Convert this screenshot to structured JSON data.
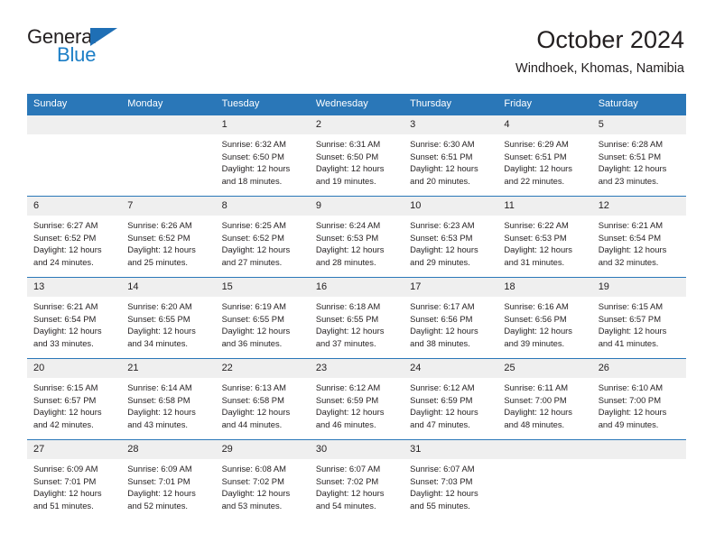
{
  "brand": {
    "name_top": "General",
    "name_bottom": "Blue",
    "accent_color": "#1b7ec6",
    "triangle_color": "#1f6fb5"
  },
  "header": {
    "title": "October 2024",
    "subtitle": "Windhoek, Khomas, Namibia"
  },
  "theme": {
    "header_bg": "#2a77b8",
    "daynum_bg": "#efefef",
    "text_color": "#231f20"
  },
  "columns": [
    "Sunday",
    "Monday",
    "Tuesday",
    "Wednesday",
    "Thursday",
    "Friday",
    "Saturday"
  ],
  "weeks": [
    [
      {
        "day": "",
        "empty": true
      },
      {
        "day": "",
        "empty": true
      },
      {
        "day": "1",
        "sunrise": "Sunrise: 6:32 AM",
        "sunset": "Sunset: 6:50 PM",
        "daylight": "Daylight: 12 hours and 18 minutes."
      },
      {
        "day": "2",
        "sunrise": "Sunrise: 6:31 AM",
        "sunset": "Sunset: 6:50 PM",
        "daylight": "Daylight: 12 hours and 19 minutes."
      },
      {
        "day": "3",
        "sunrise": "Sunrise: 6:30 AM",
        "sunset": "Sunset: 6:51 PM",
        "daylight": "Daylight: 12 hours and 20 minutes."
      },
      {
        "day": "4",
        "sunrise": "Sunrise: 6:29 AM",
        "sunset": "Sunset: 6:51 PM",
        "daylight": "Daylight: 12 hours and 22 minutes."
      },
      {
        "day": "5",
        "sunrise": "Sunrise: 6:28 AM",
        "sunset": "Sunset: 6:51 PM",
        "daylight": "Daylight: 12 hours and 23 minutes."
      }
    ],
    [
      {
        "day": "6",
        "sunrise": "Sunrise: 6:27 AM",
        "sunset": "Sunset: 6:52 PM",
        "daylight": "Daylight: 12 hours and 24 minutes."
      },
      {
        "day": "7",
        "sunrise": "Sunrise: 6:26 AM",
        "sunset": "Sunset: 6:52 PM",
        "daylight": "Daylight: 12 hours and 25 minutes."
      },
      {
        "day": "8",
        "sunrise": "Sunrise: 6:25 AM",
        "sunset": "Sunset: 6:52 PM",
        "daylight": "Daylight: 12 hours and 27 minutes."
      },
      {
        "day": "9",
        "sunrise": "Sunrise: 6:24 AM",
        "sunset": "Sunset: 6:53 PM",
        "daylight": "Daylight: 12 hours and 28 minutes."
      },
      {
        "day": "10",
        "sunrise": "Sunrise: 6:23 AM",
        "sunset": "Sunset: 6:53 PM",
        "daylight": "Daylight: 12 hours and 29 minutes."
      },
      {
        "day": "11",
        "sunrise": "Sunrise: 6:22 AM",
        "sunset": "Sunset: 6:53 PM",
        "daylight": "Daylight: 12 hours and 31 minutes."
      },
      {
        "day": "12",
        "sunrise": "Sunrise: 6:21 AM",
        "sunset": "Sunset: 6:54 PM",
        "daylight": "Daylight: 12 hours and 32 minutes."
      }
    ],
    [
      {
        "day": "13",
        "sunrise": "Sunrise: 6:21 AM",
        "sunset": "Sunset: 6:54 PM",
        "daylight": "Daylight: 12 hours and 33 minutes."
      },
      {
        "day": "14",
        "sunrise": "Sunrise: 6:20 AM",
        "sunset": "Sunset: 6:55 PM",
        "daylight": "Daylight: 12 hours and 34 minutes."
      },
      {
        "day": "15",
        "sunrise": "Sunrise: 6:19 AM",
        "sunset": "Sunset: 6:55 PM",
        "daylight": "Daylight: 12 hours and 36 minutes."
      },
      {
        "day": "16",
        "sunrise": "Sunrise: 6:18 AM",
        "sunset": "Sunset: 6:55 PM",
        "daylight": "Daylight: 12 hours and 37 minutes."
      },
      {
        "day": "17",
        "sunrise": "Sunrise: 6:17 AM",
        "sunset": "Sunset: 6:56 PM",
        "daylight": "Daylight: 12 hours and 38 minutes."
      },
      {
        "day": "18",
        "sunrise": "Sunrise: 6:16 AM",
        "sunset": "Sunset: 6:56 PM",
        "daylight": "Daylight: 12 hours and 39 minutes."
      },
      {
        "day": "19",
        "sunrise": "Sunrise: 6:15 AM",
        "sunset": "Sunset: 6:57 PM",
        "daylight": "Daylight: 12 hours and 41 minutes."
      }
    ],
    [
      {
        "day": "20",
        "sunrise": "Sunrise: 6:15 AM",
        "sunset": "Sunset: 6:57 PM",
        "daylight": "Daylight: 12 hours and 42 minutes."
      },
      {
        "day": "21",
        "sunrise": "Sunrise: 6:14 AM",
        "sunset": "Sunset: 6:58 PM",
        "daylight": "Daylight: 12 hours and 43 minutes."
      },
      {
        "day": "22",
        "sunrise": "Sunrise: 6:13 AM",
        "sunset": "Sunset: 6:58 PM",
        "daylight": "Daylight: 12 hours and 44 minutes."
      },
      {
        "day": "23",
        "sunrise": "Sunrise: 6:12 AM",
        "sunset": "Sunset: 6:59 PM",
        "daylight": "Daylight: 12 hours and 46 minutes."
      },
      {
        "day": "24",
        "sunrise": "Sunrise: 6:12 AM",
        "sunset": "Sunset: 6:59 PM",
        "daylight": "Daylight: 12 hours and 47 minutes."
      },
      {
        "day": "25",
        "sunrise": "Sunrise: 6:11 AM",
        "sunset": "Sunset: 7:00 PM",
        "daylight": "Daylight: 12 hours and 48 minutes."
      },
      {
        "day": "26",
        "sunrise": "Sunrise: 6:10 AM",
        "sunset": "Sunset: 7:00 PM",
        "daylight": "Daylight: 12 hours and 49 minutes."
      }
    ],
    [
      {
        "day": "27",
        "sunrise": "Sunrise: 6:09 AM",
        "sunset": "Sunset: 7:01 PM",
        "daylight": "Daylight: 12 hours and 51 minutes."
      },
      {
        "day": "28",
        "sunrise": "Sunrise: 6:09 AM",
        "sunset": "Sunset: 7:01 PM",
        "daylight": "Daylight: 12 hours and 52 minutes."
      },
      {
        "day": "29",
        "sunrise": "Sunrise: 6:08 AM",
        "sunset": "Sunset: 7:02 PM",
        "daylight": "Daylight: 12 hours and 53 minutes."
      },
      {
        "day": "30",
        "sunrise": "Sunrise: 6:07 AM",
        "sunset": "Sunset: 7:02 PM",
        "daylight": "Daylight: 12 hours and 54 minutes."
      },
      {
        "day": "31",
        "sunrise": "Sunrise: 6:07 AM",
        "sunset": "Sunset: 7:03 PM",
        "daylight": "Daylight: 12 hours and 55 minutes."
      },
      {
        "day": "",
        "empty": true
      },
      {
        "day": "",
        "empty": true
      }
    ]
  ]
}
